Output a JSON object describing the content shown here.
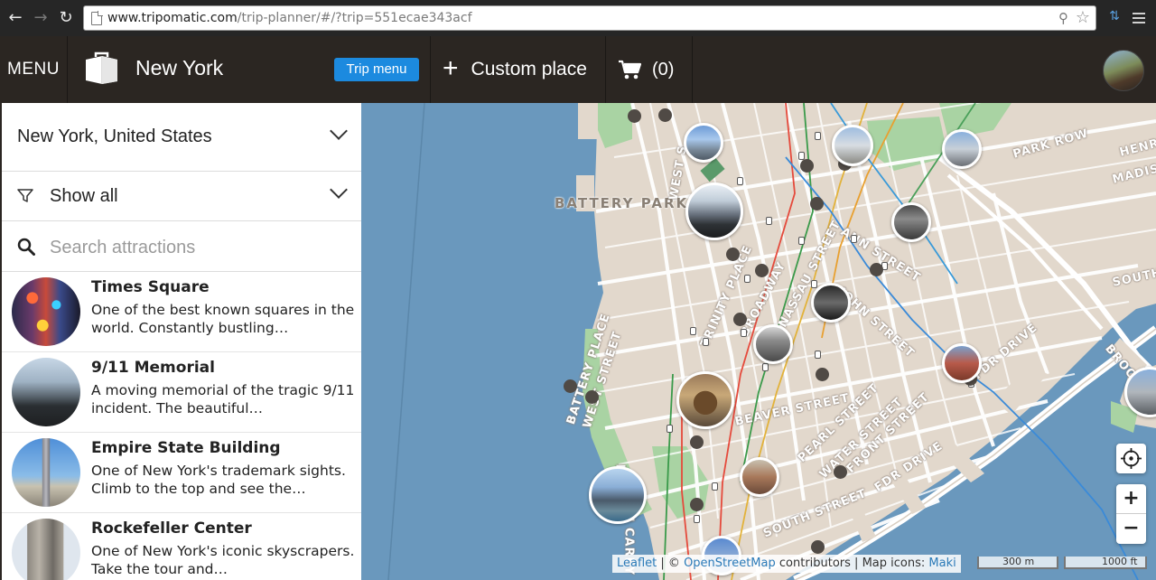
{
  "browser": {
    "url_host": "www.tripomatic.com",
    "url_path": "/trip-planner/#/?trip=551ecae343acf"
  },
  "header": {
    "menu_label": "MENU",
    "city": "New York",
    "trip_menu_label": "Trip menu",
    "custom_place_label": "Custom place",
    "cart_count": "(0)"
  },
  "sidebar": {
    "location": "New York, United States",
    "filter_label": "Show all",
    "search_placeholder": "Search attractions",
    "attractions": [
      {
        "name": "Times Square",
        "description": "One of the best known squares in the world. Constantly bustling…"
      },
      {
        "name": "9/11 Memorial",
        "description": "A moving memorial of the tragic 9/11 incident. The beautiful…"
      },
      {
        "name": "Empire State Building",
        "description": "One of New York's trademark sights. Climb to the top and see the…"
      },
      {
        "name": "Rockefeller Center",
        "description": "One of New York's iconic skyscrapers. Take the tour and…"
      }
    ]
  },
  "map": {
    "labels": {
      "battery_park_city": "BATTERY PARK CITY",
      "west_st": "WEST S",
      "park_row": "PARK ROW",
      "henry": "HENRY",
      "madison": "MADISO",
      "ann_st": "ANN STREET",
      "nassau_st": "NASSAU STREET",
      "john_st": "JOHN STREET",
      "trinity_place": "TRINITY PLACE",
      "broadway": "BROADWAY",
      "battery_place": "BATTERY PLACE",
      "west_street": "WEST STREET",
      "beaver_st": "BEAVER STREET",
      "pearl_st": "PEARL STREET",
      "water_st": "WATER STREET",
      "front_st": "FRONT STREET",
      "fdr_drive_1": "FDR DRIVE",
      "fdr_drive_2": "FDR DRIVE",
      "south_st": "SOUTH STREET",
      "south": "SOUTH",
      "brook": "BROOK",
      "fdr_vertical": "FD",
      "hugh_carey": "HUGH CAREY"
    },
    "attribution": {
      "leaflet": "Leaflet",
      "copy": "| ©",
      "osm": "OpenStreetMap",
      "contributors": "contributors | Map icons:",
      "maki": "Maki"
    },
    "scale_metric": "300 m",
    "scale_imperial": "1000 ft",
    "zoom_in": "+",
    "zoom_out": "−"
  },
  "colors": {
    "header_bg": "#2b2622",
    "accent_blue": "#1c8adf",
    "water": "#6a98bd",
    "land": "#e2d8cc",
    "park": "#a9d3a3"
  }
}
